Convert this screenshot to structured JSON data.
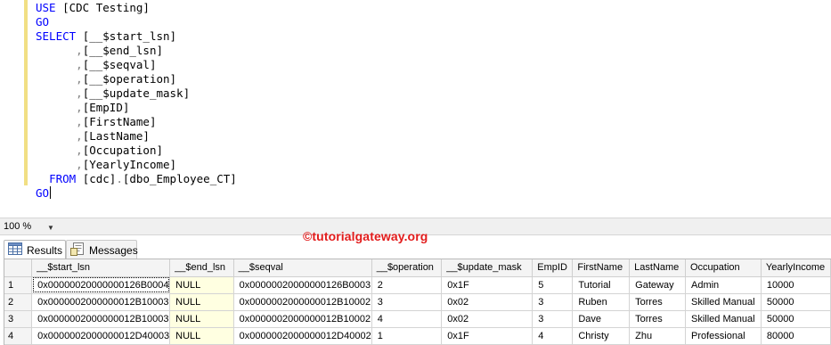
{
  "editor": {
    "lines": [
      {
        "parts": [
          {
            "t": "USE",
            "c": "kw"
          },
          {
            "t": " ",
            "c": "tk"
          },
          {
            "t": "[CDC Testing]",
            "c": "id"
          }
        ]
      },
      {
        "parts": [
          {
            "t": "GO",
            "c": "kw"
          }
        ]
      },
      {
        "parts": [
          {
            "t": "SELECT",
            "c": "kw"
          },
          {
            "t": " ",
            "c": "tk"
          },
          {
            "t": "[__$start_lsn]",
            "c": "id"
          }
        ]
      },
      {
        "parts": [
          {
            "t": "      ",
            "c": "tk"
          },
          {
            "t": ",",
            "c": "pn"
          },
          {
            "t": "[__$end_lsn]",
            "c": "id"
          }
        ]
      },
      {
        "parts": [
          {
            "t": "      ",
            "c": "tk"
          },
          {
            "t": ",",
            "c": "pn"
          },
          {
            "t": "[__$seqval]",
            "c": "id"
          }
        ]
      },
      {
        "parts": [
          {
            "t": "      ",
            "c": "tk"
          },
          {
            "t": ",",
            "c": "pn"
          },
          {
            "t": "[__$operation]",
            "c": "id"
          }
        ]
      },
      {
        "parts": [
          {
            "t": "      ",
            "c": "tk"
          },
          {
            "t": ",",
            "c": "pn"
          },
          {
            "t": "[__$update_mask]",
            "c": "id"
          }
        ]
      },
      {
        "parts": [
          {
            "t": "      ",
            "c": "tk"
          },
          {
            "t": ",",
            "c": "pn"
          },
          {
            "t": "[EmpID]",
            "c": "id"
          }
        ]
      },
      {
        "parts": [
          {
            "t": "      ",
            "c": "tk"
          },
          {
            "t": ",",
            "c": "pn"
          },
          {
            "t": "[FirstName]",
            "c": "id"
          }
        ]
      },
      {
        "parts": [
          {
            "t": "      ",
            "c": "tk"
          },
          {
            "t": ",",
            "c": "pn"
          },
          {
            "t": "[LastName]",
            "c": "id"
          }
        ]
      },
      {
        "parts": [
          {
            "t": "      ",
            "c": "tk"
          },
          {
            "t": ",",
            "c": "pn"
          },
          {
            "t": "[Occupation]",
            "c": "id"
          }
        ]
      },
      {
        "parts": [
          {
            "t": "      ",
            "c": "tk"
          },
          {
            "t": ",",
            "c": "pn"
          },
          {
            "t": "[YearlyIncome]",
            "c": "id"
          }
        ]
      },
      {
        "parts": [
          {
            "t": "  ",
            "c": "tk"
          },
          {
            "t": "FROM",
            "c": "kw"
          },
          {
            "t": " ",
            "c": "tk"
          },
          {
            "t": "[cdc]",
            "c": "id"
          },
          {
            "t": ".",
            "c": "pn"
          },
          {
            "t": "[dbo_Employee_CT]",
            "c": "id"
          }
        ]
      },
      {
        "parts": [
          {
            "t": "GO",
            "c": "kw"
          }
        ],
        "caret": true
      }
    ]
  },
  "zoom": {
    "value": "100 %",
    "arrow": "▼"
  },
  "tabs": {
    "results": "Results",
    "messages": "Messages"
  },
  "watermark": "©tutorialgateway.org",
  "grid": {
    "columns": [
      "__$start_lsn",
      "__$end_lsn",
      "__$seqval",
      "__$operation",
      "__$update_mask",
      "EmpID",
      "FirstName",
      "LastName",
      "Occupation",
      "YearlyIncome"
    ],
    "rows": [
      {
        "num": "1",
        "cells": [
          "0x00000020000000126B0004",
          "NULL",
          "0x00000020000000126B0003",
          "2",
          "0x1F",
          "5",
          "Tutorial",
          "Gateway",
          "Admin",
          "10000"
        ]
      },
      {
        "num": "2",
        "cells": [
          "0x0000002000000012B10003",
          "NULL",
          "0x0000002000000012B10002",
          "3",
          "0x02",
          "3",
          "Ruben",
          "Torres",
          "Skilled Manual",
          "50000"
        ]
      },
      {
        "num": "3",
        "cells": [
          "0x0000002000000012B10003",
          "NULL",
          "0x0000002000000012B10002",
          "4",
          "0x02",
          "3",
          "Dave",
          "Torres",
          "Skilled Manual",
          "50000"
        ]
      },
      {
        "num": "4",
        "cells": [
          "0x0000002000000012D40003",
          "NULL",
          "0x0000002000000012D40002",
          "1",
          "0x1F",
          "4",
          "Christy",
          "Zhu",
          "Professional",
          "80000"
        ]
      }
    ]
  },
  "colors": {
    "keyword": "#0000ff",
    "null_bg": "#ffffe1",
    "watermark": "#e21b1b",
    "margin_strip": "#f1df84"
  },
  "icons": {
    "results_tab": "grid-icon",
    "messages_tab": "messages-icon"
  }
}
